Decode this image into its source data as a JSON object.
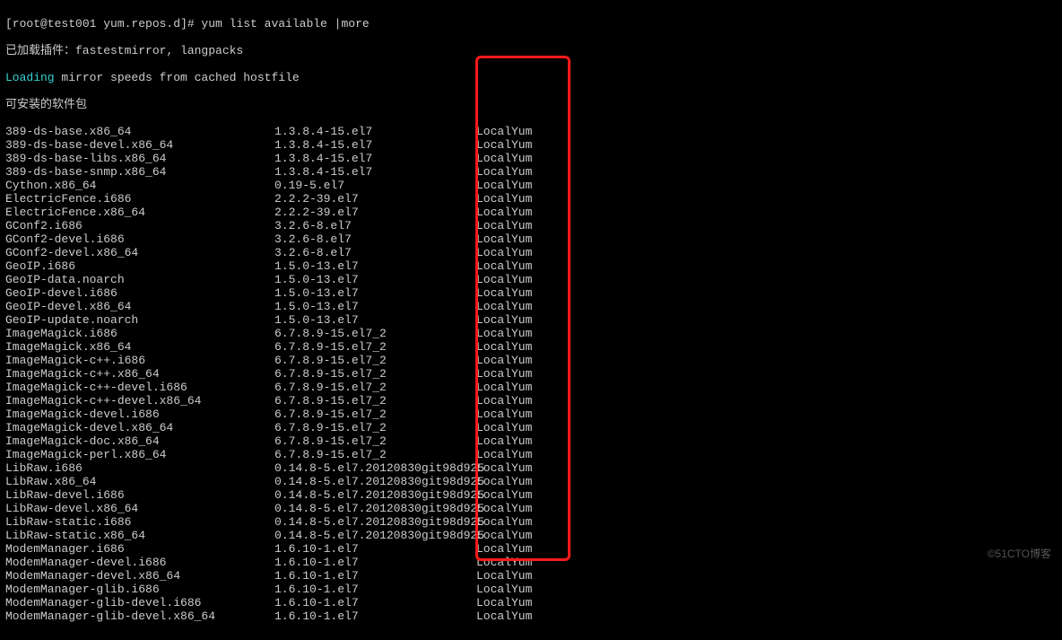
{
  "prompt": {
    "full": "[root@test001 yum.repos.d]# yum list available |more"
  },
  "plugin_line": "已加载插件：fastestmirror, langpacks",
  "loading_word": "Loading",
  "loading_rest": " mirror speeds from cached hostfile",
  "section_header": "可安装的软件包",
  "watermark": "©51CTO博客",
  "packages": [
    {
      "name": "389-ds-base.x86_64",
      "version": "1.3.8.4-15.el7",
      "repo": "LocalYum"
    },
    {
      "name": "389-ds-base-devel.x86_64",
      "version": "1.3.8.4-15.el7",
      "repo": "LocalYum"
    },
    {
      "name": "389-ds-base-libs.x86_64",
      "version": "1.3.8.4-15.el7",
      "repo": "LocalYum"
    },
    {
      "name": "389-ds-base-snmp.x86_64",
      "version": "1.3.8.4-15.el7",
      "repo": "LocalYum"
    },
    {
      "name": "Cython.x86_64",
      "version": "0.19-5.el7",
      "repo": "LocalYum"
    },
    {
      "name": "ElectricFence.i686",
      "version": "2.2.2-39.el7",
      "repo": "LocalYum"
    },
    {
      "name": "ElectricFence.x86_64",
      "version": "2.2.2-39.el7",
      "repo": "LocalYum"
    },
    {
      "name": "GConf2.i686",
      "version": "3.2.6-8.el7",
      "repo": "LocalYum"
    },
    {
      "name": "GConf2-devel.i686",
      "version": "3.2.6-8.el7",
      "repo": "LocalYum"
    },
    {
      "name": "GConf2-devel.x86_64",
      "version": "3.2.6-8.el7",
      "repo": "LocalYum"
    },
    {
      "name": "GeoIP.i686",
      "version": "1.5.0-13.el7",
      "repo": "LocalYum"
    },
    {
      "name": "GeoIP-data.noarch",
      "version": "1.5.0-13.el7",
      "repo": "LocalYum"
    },
    {
      "name": "GeoIP-devel.i686",
      "version": "1.5.0-13.el7",
      "repo": "LocalYum"
    },
    {
      "name": "GeoIP-devel.x86_64",
      "version": "1.5.0-13.el7",
      "repo": "LocalYum"
    },
    {
      "name": "GeoIP-update.noarch",
      "version": "1.5.0-13.el7",
      "repo": "LocalYum"
    },
    {
      "name": "ImageMagick.i686",
      "version": "6.7.8.9-15.el7_2",
      "repo": "LocalYum"
    },
    {
      "name": "ImageMagick.x86_64",
      "version": "6.7.8.9-15.el7_2",
      "repo": "LocalYum"
    },
    {
      "name": "ImageMagick-c++.i686",
      "version": "6.7.8.9-15.el7_2",
      "repo": "LocalYum"
    },
    {
      "name": "ImageMagick-c++.x86_64",
      "version": "6.7.8.9-15.el7_2",
      "repo": "LocalYum"
    },
    {
      "name": "ImageMagick-c++-devel.i686",
      "version": "6.7.8.9-15.el7_2",
      "repo": "LocalYum"
    },
    {
      "name": "ImageMagick-c++-devel.x86_64",
      "version": "6.7.8.9-15.el7_2",
      "repo": "LocalYum"
    },
    {
      "name": "ImageMagick-devel.i686",
      "version": "6.7.8.9-15.el7_2",
      "repo": "LocalYum"
    },
    {
      "name": "ImageMagick-devel.x86_64",
      "version": "6.7.8.9-15.el7_2",
      "repo": "LocalYum"
    },
    {
      "name": "ImageMagick-doc.x86_64",
      "version": "6.7.8.9-15.el7_2",
      "repo": "LocalYum"
    },
    {
      "name": "ImageMagick-perl.x86_64",
      "version": "6.7.8.9-15.el7_2",
      "repo": "LocalYum"
    },
    {
      "name": "LibRaw.i686",
      "version": "0.14.8-5.el7.20120830git98d925",
      "repo": "LocalYum"
    },
    {
      "name": "LibRaw.x86_64",
      "version": "0.14.8-5.el7.20120830git98d925",
      "repo": "LocalYum"
    },
    {
      "name": "LibRaw-devel.i686",
      "version": "0.14.8-5.el7.20120830git98d925",
      "repo": "LocalYum"
    },
    {
      "name": "LibRaw-devel.x86_64",
      "version": "0.14.8-5.el7.20120830git98d925",
      "repo": "LocalYum"
    },
    {
      "name": "LibRaw-static.i686",
      "version": "0.14.8-5.el7.20120830git98d925",
      "repo": "LocalYum"
    },
    {
      "name": "LibRaw-static.x86_64",
      "version": "0.14.8-5.el7.20120830git98d925",
      "repo": "LocalYum"
    },
    {
      "name": "ModemManager.i686",
      "version": "1.6.10-1.el7",
      "repo": "LocalYum"
    },
    {
      "name": "ModemManager-devel.i686",
      "version": "1.6.10-1.el7",
      "repo": "LocalYum"
    },
    {
      "name": "ModemManager-devel.x86_64",
      "version": "1.6.10-1.el7",
      "repo": "LocalYum"
    },
    {
      "name": "ModemManager-glib.i686",
      "version": "1.6.10-1.el7",
      "repo": "LocalYum"
    },
    {
      "name": "ModemManager-glib-devel.i686",
      "version": "1.6.10-1.el7",
      "repo": "LocalYum"
    },
    {
      "name": "ModemManager-glib-devel.x86_64",
      "version": "1.6.10-1.el7",
      "repo": "LocalYum"
    }
  ]
}
